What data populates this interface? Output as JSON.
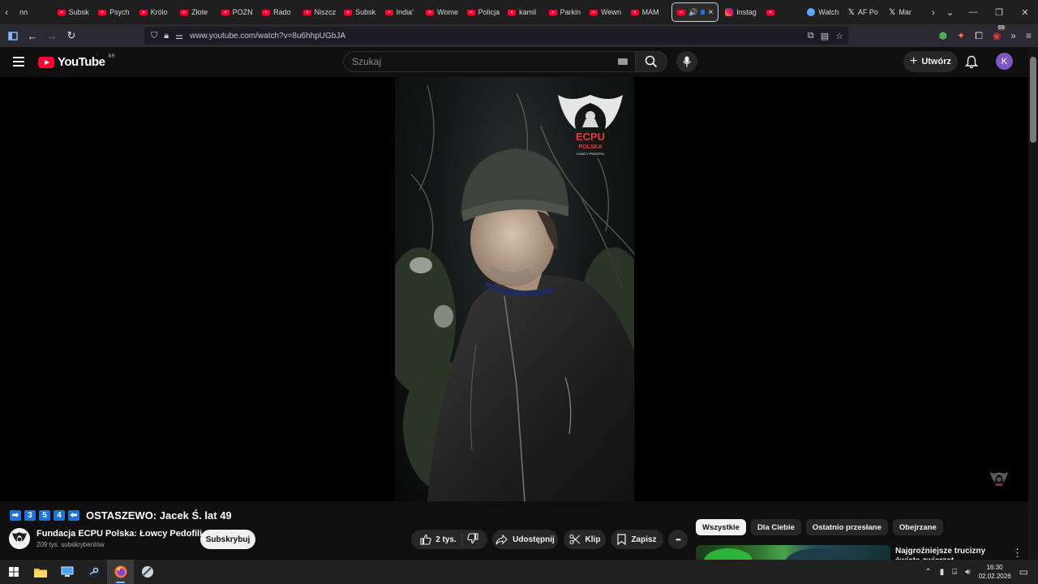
{
  "browser": {
    "tabs": [
      {
        "label": "nn",
        "icon": "none"
      },
      {
        "label": "Subsk",
        "icon": "youtube"
      },
      {
        "label": "Psych",
        "icon": "youtube"
      },
      {
        "label": "Królo",
        "icon": "youtube"
      },
      {
        "label": "Złote",
        "icon": "youtube"
      },
      {
        "label": "POZN",
        "icon": "youtube"
      },
      {
        "label": "Rado",
        "icon": "youtube"
      },
      {
        "label": "Niszcz",
        "icon": "youtube"
      },
      {
        "label": "Subsk",
        "icon": "youtube"
      },
      {
        "label": "India'",
        "icon": "youtube"
      },
      {
        "label": "Wome",
        "icon": "youtube"
      },
      {
        "label": "Policja",
        "icon": "youtube"
      },
      {
        "label": "kamil",
        "icon": "youtube"
      },
      {
        "label": "Parkin",
        "icon": "youtube"
      },
      {
        "label": "Wewn",
        "icon": "youtube"
      },
      {
        "label": "MAM",
        "icon": "youtube"
      }
    ],
    "active_tab_close": "×",
    "tabs_after": [
      {
        "label": "Instag",
        "icon": "instagram"
      },
      {
        "label": "",
        "icon": "youtube"
      },
      {
        "label": "Watch",
        "icon": "blue"
      },
      {
        "label": "AF Po",
        "icon": "x"
      },
      {
        "label": "Mar",
        "icon": "x"
      }
    ],
    "url": "www.youtube.com/watch?v=8u6hhpUGbJA"
  },
  "youtube": {
    "logo_text": "YouTube",
    "country_code": "BR",
    "search_placeholder": "Szukaj",
    "create_label": "Utwórz",
    "avatar_letter": "K"
  },
  "video": {
    "title_prefix_keys": [
      "➡",
      "3",
      "5",
      "4",
      "⬅"
    ],
    "title": "OSTASZEWO: Jacek Ś. lat 49",
    "channel_name": "Fundacja ECPU Polska: Łowcy Pedofili",
    "subscribers": "209 tys. subskrybentów",
    "subscribe_label": "Subskrybuj",
    "likes": "2 tys.",
    "share_label": "Udostępnij",
    "clip_label": "Klip",
    "save_label": "Zapisz",
    "more_label": "•••",
    "watermark_lines": [
      "ECPU",
      "POLSKA",
      "ŁOWCY PEDOFILI"
    ]
  },
  "chips": [
    "Wszystkie",
    "Dla Ciebie",
    "Ostatnio przesłane",
    "Obejrzane"
  ],
  "recommendation": {
    "title": "Najgroźniejsze trucizny świata zwierząt",
    "more": "⋮"
  },
  "taskbar": {
    "time": "16:30",
    "date": "02.02.2026"
  },
  "colors": {
    "youtube_red": "#ff0033",
    "background": "#0f0f0f",
    "avatar": "#7e57c2",
    "key_blue": "#1e73d8"
  }
}
